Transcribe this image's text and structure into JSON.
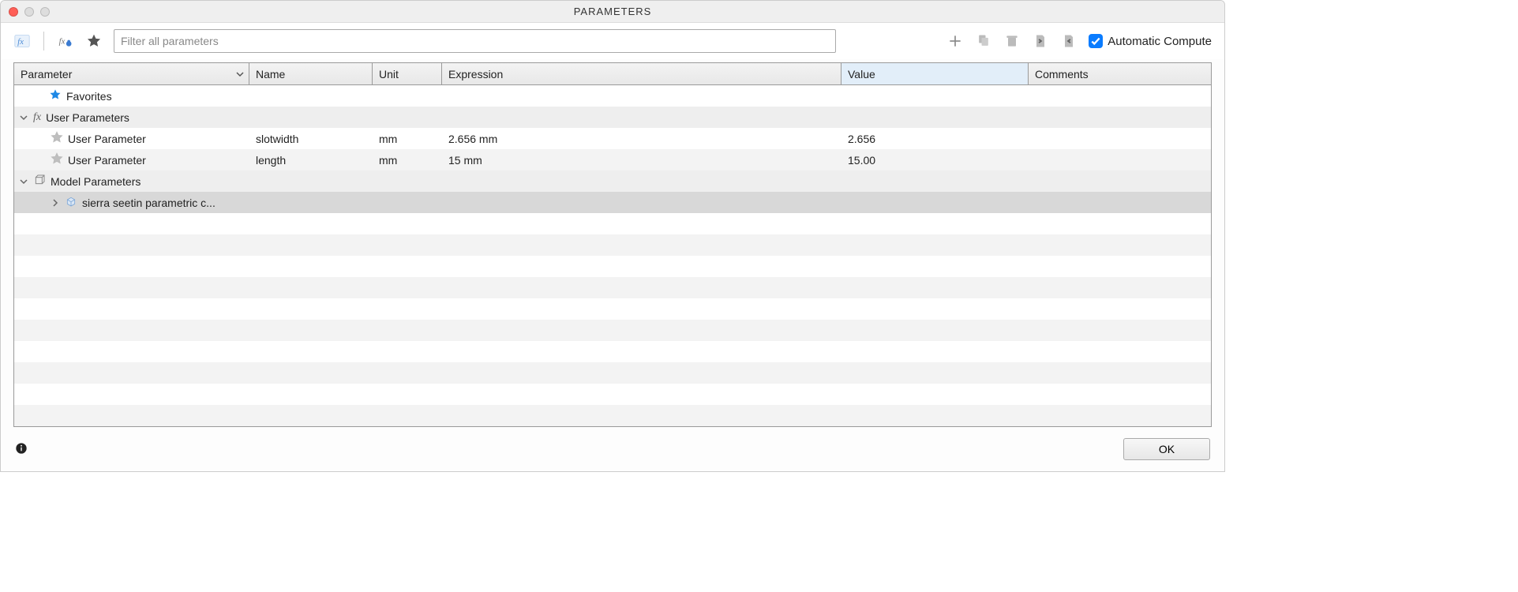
{
  "window": {
    "title": "PARAMETERS"
  },
  "toolbar": {
    "filter_placeholder": "Filter all parameters",
    "auto_compute_label": "Automatic Compute",
    "auto_compute_checked": true
  },
  "columns": {
    "parameter": "Parameter",
    "name": "Name",
    "unit": "Unit",
    "expression": "Expression",
    "value": "Value",
    "comments": "Comments"
  },
  "groups": {
    "favorites": {
      "label": "Favorites"
    },
    "user_parameters": {
      "label": "User Parameters",
      "rows": [
        {
          "parameter": "User Parameter",
          "name": "slotwidth",
          "unit": "mm",
          "expression": "2.656 mm",
          "value": "2.656",
          "comments": ""
        },
        {
          "parameter": "User Parameter",
          "name": "length",
          "unit": "mm",
          "expression": "15 mm",
          "value": "15.00",
          "comments": ""
        }
      ]
    },
    "model_parameters": {
      "label": "Model Parameters",
      "children": [
        {
          "label": "sierra seetin parametric c..."
        }
      ]
    }
  },
  "footer": {
    "ok_label": "OK"
  }
}
